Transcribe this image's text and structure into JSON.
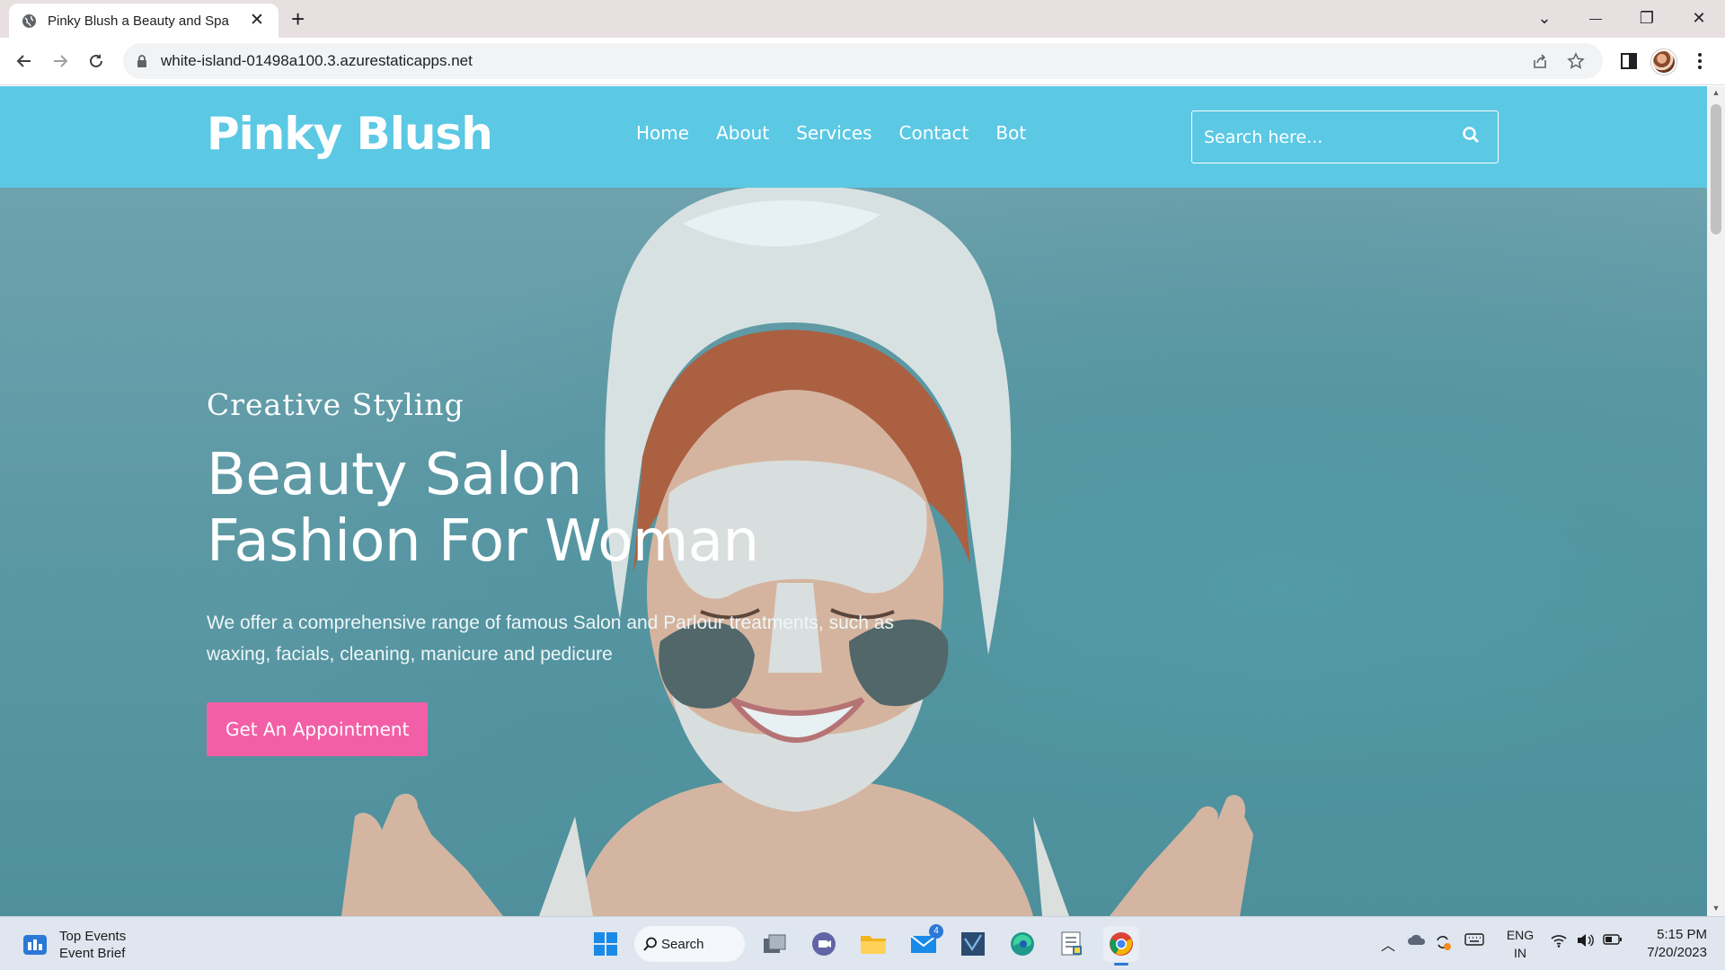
{
  "browser": {
    "tab_title": "Pinky Blush a Beauty and Spa",
    "tab_close": "✕",
    "new_tab": "+",
    "url": "white-island-01498a100.3.azurestaticapps.net",
    "window_controls": {
      "tab_list": "⌄",
      "minimize": "—",
      "restore": "❐",
      "close": "✕"
    }
  },
  "site": {
    "brand": "Pinky Blush",
    "nav": [
      "Home",
      "About",
      "Services",
      "Contact",
      "Bot"
    ],
    "search_placeholder": "Search here...",
    "colors": {
      "header": "#5bc8e4",
      "cta": "#f35fa6",
      "hero": "#5a98a4"
    }
  },
  "hero": {
    "kicker": "Creative Styling",
    "headline_line1": "Beauty Salon",
    "headline_line2": "Fashion For Woman",
    "lead": "We offer a comprehensive range of famous Salon and Parlour treatments, such as waxing, facials, cleaning, manicure and pedicure",
    "cta": "Get An Appointment"
  },
  "taskbar": {
    "widget_title": "Top Events",
    "widget_subtitle": "Event Brief",
    "search_label": "Search",
    "mail_badge": "4",
    "lang_line1": "ENG",
    "lang_line2": "IN",
    "time": "5:15 PM",
    "date": "7/20/2023"
  }
}
